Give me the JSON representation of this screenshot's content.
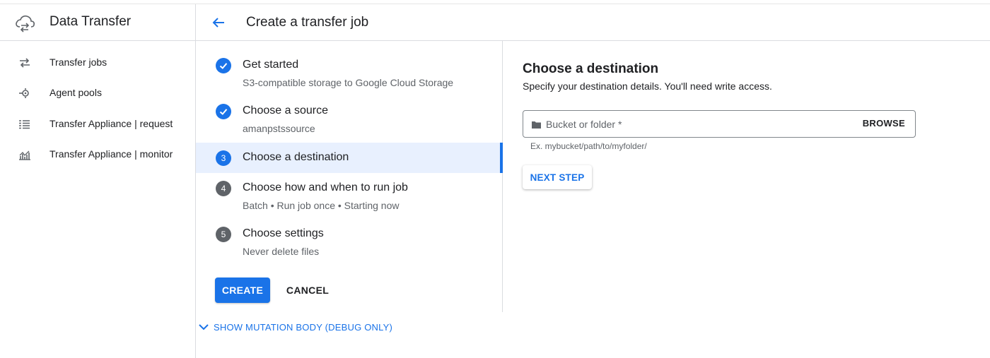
{
  "app": {
    "title": "Data Transfer",
    "logo_icon": "cloud-sync-icon"
  },
  "sidebar": {
    "items": [
      {
        "label": "Transfer jobs",
        "icon": "swap-arrows-icon"
      },
      {
        "label": "Agent pools",
        "icon": "agent-pool-icon"
      },
      {
        "label": "Transfer Appliance | request",
        "icon": "list-icon"
      },
      {
        "label": "Transfer Appliance | monitor",
        "icon": "chart-icon"
      }
    ]
  },
  "header": {
    "back_icon": "arrow-back-icon",
    "title": "Create a transfer job"
  },
  "steps": [
    {
      "number": "",
      "status": "done",
      "title": "Get started",
      "subtitle": "S3-compatible storage to Google Cloud Storage"
    },
    {
      "number": "",
      "status": "done",
      "title": "Choose a source",
      "subtitle": "amanpstssource"
    },
    {
      "number": "3",
      "status": "active",
      "title": "Choose a destination",
      "subtitle": ""
    },
    {
      "number": "4",
      "status": "todo",
      "title": "Choose how and when to run job",
      "subtitle": "Batch • Run job once • Starting now"
    },
    {
      "number": "5",
      "status": "todo",
      "title": "Choose settings",
      "subtitle": "Never delete files"
    }
  ],
  "actions": {
    "create_label": "CREATE",
    "cancel_label": "CANCEL",
    "debug_label": "SHOW MUTATION BODY (DEBUG ONLY)"
  },
  "destination": {
    "title": "Choose a destination",
    "subtitle": "Specify your destination details. You'll need write access.",
    "field_placeholder": "Bucket or folder *",
    "field_value": "",
    "browse_label": "BROWSE",
    "hint": "Ex. mybucket/path/to/myfolder/",
    "next_label": "NEXT STEP"
  },
  "colors": {
    "primary": "#1a73e8",
    "active_bg": "#e8f0fe",
    "todo_badge": "#5f6368"
  }
}
